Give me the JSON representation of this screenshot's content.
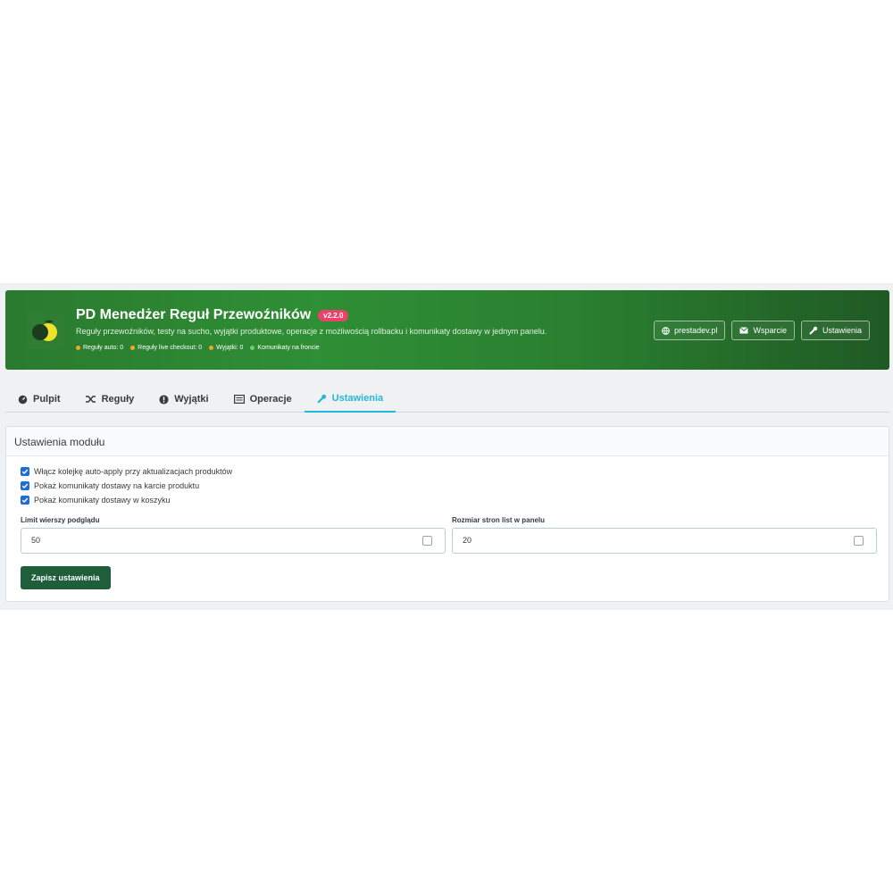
{
  "header": {
    "title": "PD Menedżer Reguł Przewoźników",
    "version": "v2.2.0",
    "subtitle": "Reguły przewoźników, testy na sucho, wyjątki produktowe, operacje z możliwością rollbacku i komunikaty dostawy w jednym panelu.",
    "stats": [
      {
        "label": "Reguły auto: 0",
        "color": "#f5a623"
      },
      {
        "label": "Reguły live checkout: 0",
        "color": "#f5a623"
      },
      {
        "label": "Wyjątki: 0",
        "color": "#f5a623"
      },
      {
        "label": "Komunikaty na froncie",
        "color": "#6fcf73"
      }
    ],
    "actions": {
      "website": "prestadev.pl",
      "support": "Wsparcie",
      "settings": "Ustawienia"
    }
  },
  "tabs": [
    {
      "label": "Pulpit",
      "icon": "dashboard-icon",
      "active": false
    },
    {
      "label": "Reguły",
      "icon": "shuffle-icon",
      "active": false
    },
    {
      "label": "Wyjątki",
      "icon": "exclamation-icon",
      "active": false
    },
    {
      "label": "Operacje",
      "icon": "list-icon",
      "active": false
    },
    {
      "label": "Ustawienia",
      "icon": "wrench-icon",
      "active": true
    }
  ],
  "settings_card": {
    "title": "Ustawienia modułu",
    "checkboxes": [
      {
        "label": "Włącz kolejkę auto-apply przy aktualizacjach produktów",
        "checked": true
      },
      {
        "label": "Pokaż komunikaty dostawy na karcie produktu",
        "checked": true
      },
      {
        "label": "Pokaż komunikaty dostawy w koszyku",
        "checked": true
      }
    ],
    "preview_limit": {
      "label": "Limit wierszy podglądu",
      "value": "50"
    },
    "page_size": {
      "label": "Rozmiar stron list w panelu",
      "value": "20"
    },
    "save_label": "Zapisz ustawienia"
  },
  "colors": {
    "accent": "#25b9d7",
    "brand": "#2e7d32",
    "badge": "#e8436b",
    "save": "#1f5e3a"
  }
}
